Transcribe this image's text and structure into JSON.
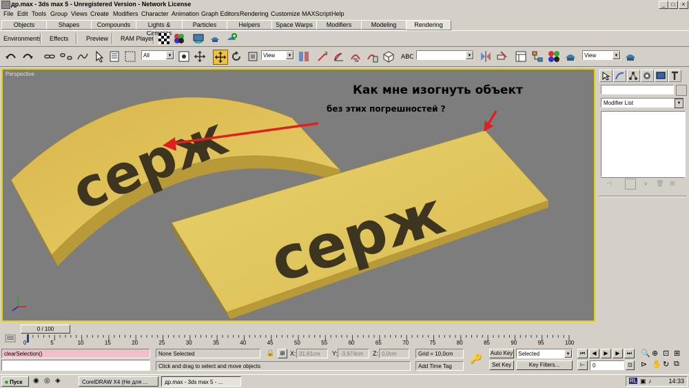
{
  "window": {
    "title": "др.max - 3ds max 5 - Unregistered Version - Network License",
    "min": "_",
    "max": "□",
    "close": "×"
  },
  "menu": [
    "File",
    "Edit",
    "Tools",
    "Group",
    "Views",
    "Create",
    "Modifiers",
    "Character",
    "Animation",
    "Graph Editors",
    "Rendering",
    "Customize",
    "MAXScript",
    "Help"
  ],
  "tabs": [
    "Objects",
    "Shapes",
    "Compounds",
    "Lights & Cameras",
    "Particles",
    "Helpers",
    "Space Warps",
    "Modifiers",
    "Modeling",
    "Rendering"
  ],
  "active_tab": "Rendering",
  "render_toolbar": {
    "environments": "Environments",
    "effects": "Effects",
    "preview": "Preview",
    "ram_player": "RAM Player"
  },
  "main_toolbar": {
    "selection_filter": "All",
    "ref_coord": "View",
    "ref_coord2": "View",
    "named_sel": ""
  },
  "viewport": {
    "label": "Perspective",
    "annotation_line1": "Как мне изогнуть объект",
    "annotation_line2": "без этих погрешностей ?",
    "object_text": "серж",
    "accent_color": "#e02020",
    "object_color": "#e2c24a"
  },
  "command_panel": {
    "name_field": "",
    "modifier_list": "Modifier List"
  },
  "timeline": {
    "slider": "0 / 100",
    "ticks": [
      "0",
      "5",
      "10",
      "15",
      "20",
      "25",
      "30",
      "35",
      "40",
      "45",
      "50",
      "55",
      "60",
      "65",
      "70",
      "75",
      "80",
      "85",
      "90",
      "95",
      "100"
    ]
  },
  "status": {
    "listener": "clearSelection()",
    "listener_input": "",
    "selection": "None Selected",
    "prompt": "Click and drag to select and move objects",
    "x_label": "X:",
    "x_value": "31,61cm",
    "y_label": "Y:",
    "y_value": "-3,974cm",
    "z_label": "Z:",
    "z_value": "0,0cm",
    "grid": "Grid = 10,0cm",
    "add_time_tag": "Add Time Tag",
    "auto_key": "Auto Key",
    "set_key": "Set Key",
    "key_mode": "Selected",
    "key_filters": "Key Filters...",
    "frame": "0"
  },
  "taskbar": {
    "start": "Пуск",
    "task1": "CorelDRAW X4 (Не для ...",
    "task2": "др.max - 3ds max 5 - ...",
    "lang": "RL",
    "clock": "14:33"
  }
}
